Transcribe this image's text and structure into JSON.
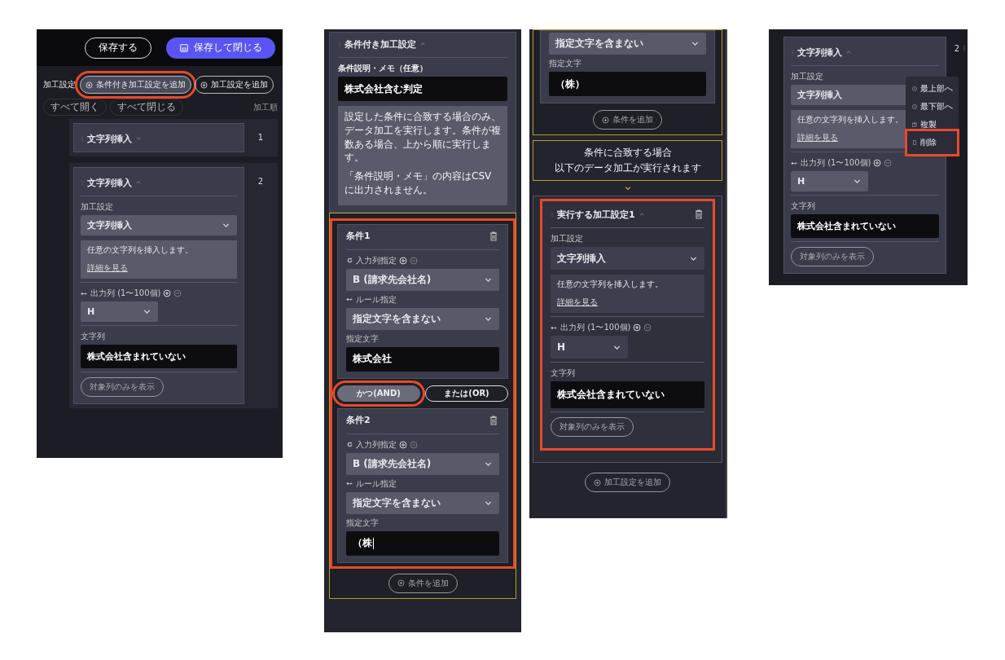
{
  "panel_1": {
    "header_buttons": [
      {
        "label": "保存する",
        "kind": "outline"
      },
      {
        "label": "保存して閉じる",
        "kind": "primary"
      }
    ],
    "section_label": "加工設定",
    "add_buttons": [
      {
        "label": "条件付き加工設定を追加",
        "highlighted": true
      },
      {
        "label": "加工設定を追加",
        "highlighted": false
      }
    ],
    "expand_buttons": [
      "すべて開く",
      "すべて閉じる"
    ],
    "order_label": "加工順",
    "items": [
      {
        "order": "1",
        "card": {
          "title": "文字列挿入",
          "expanded": false
        }
      },
      {
        "order": "2",
        "card": {
          "title": "文字列挿入",
          "expanded": true,
          "setting_label": "加工設定",
          "setting_value": "文字列挿入",
          "description": "任意の文字列を挿入します。",
          "detail_link": "詳細を見る",
          "output_label": "出力列 (1〜100個)",
          "output_value": "H",
          "string_label": "文字列",
          "string_value": "株式会社含まれていない",
          "filter_button": "対象列のみを表示"
        }
      }
    ]
  },
  "panel_2": {
    "group_title": "条件付き加工設定",
    "expanded": true,
    "memo_label": "条件説明・メモ（任意）",
    "memo_value": "株式会社含む判定",
    "info": [
      "設定した条件に合致する場合のみ、データ加工を実行します。条件が複数ある場合、上から順に実行します。",
      "「条件説明・メモ」の内容はCSVに出力されません。"
    ],
    "conditions_highlighted": true,
    "conditions": [
      {
        "title": "条件1",
        "input_label": "入力列指定",
        "input_value": "B (請求先会社名)",
        "rule_label": "ルール指定",
        "rule_value": "指定文字を含まない",
        "text_label": "指定文字",
        "text_value": "株式会社",
        "cursor": false
      },
      {
        "title": "条件2",
        "input_label": "入力列指定",
        "input_value": "B (請求先会社名)",
        "rule_label": "ルール指定",
        "rule_value": "指定文字を含まない",
        "text_label": "指定文字",
        "text_value": "（株",
        "cursor": true
      }
    ],
    "logic_options": [
      {
        "label": "かつ(AND)",
        "selected": true,
        "highlighted": true
      },
      {
        "label": "または(OR)",
        "selected": false,
        "highlighted": false
      }
    ],
    "add_condition_button": "条件を追加"
  },
  "panel_3": {
    "rule_value": "指定文字を含まない",
    "text_label": "指定文字",
    "text_value": "（株）",
    "add_condition_button": "条件を追加",
    "match_notice": [
      "条件に合致する場合",
      "以下のデータ加工が実行されます"
    ],
    "action_card": {
      "title": "実行する加工設定1",
      "expanded": true,
      "deletable": true,
      "highlighted": true,
      "setting_label": "加工設定",
      "setting_value": "文字列挿入",
      "description": "任意の文字列を挿入します。",
      "detail_link": "詳細を見る",
      "output_label": "出力列 (1〜100個)",
      "output_value": "H",
      "string_label": "文字列",
      "string_value": "株式会社含まれていない",
      "filter_button": "対象列のみを表示"
    },
    "add_processing_button": "加工設定を追加"
  },
  "panel_4": {
    "order": "2",
    "card": {
      "title": "文字列挿入",
      "expanded": true,
      "setting_label": "加工設定",
      "setting_value": "文字列挿入",
      "description": "任意の文字列を挿入します。",
      "detail_link": "詳細を見る",
      "output_label": "出力列 (1〜100個)",
      "output_value": "H",
      "string_label": "文字列",
      "string_value": "株式会社含まれていない",
      "filter_button": "対象列のみを表示"
    },
    "menu": [
      {
        "label": "最上部へ",
        "kind": "top",
        "highlighted": false
      },
      {
        "label": "最下部へ",
        "kind": "bottom",
        "highlighted": false
      },
      {
        "label": "複製",
        "kind": "copy",
        "highlighted": false
      },
      {
        "label": "削除",
        "kind": "delete",
        "highlighted": true
      }
    ]
  }
}
